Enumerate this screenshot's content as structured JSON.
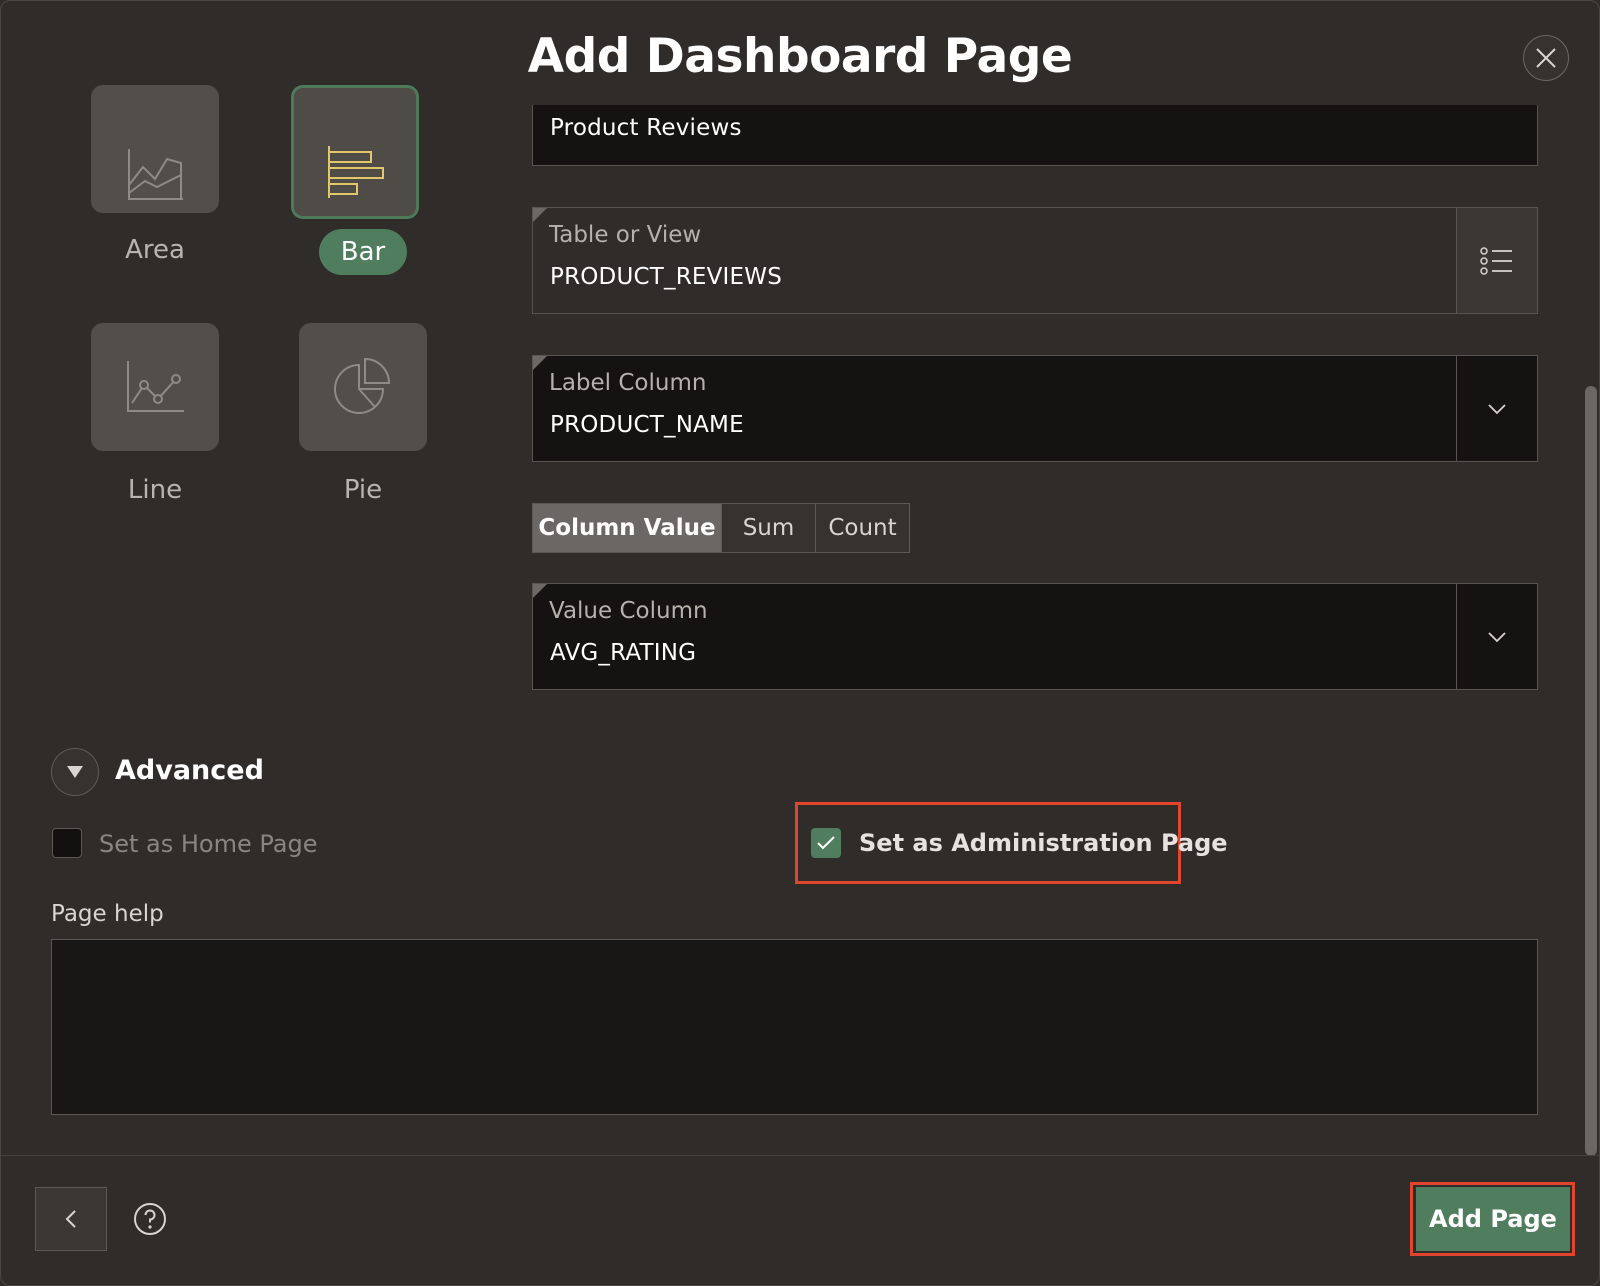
{
  "dialog": {
    "title": "Add Dashboard Page"
  },
  "chart_types": {
    "area": "Area",
    "bar": "Bar",
    "line": "Line",
    "pie": "Pie",
    "selected": "Bar"
  },
  "fields": {
    "page_name_value": "Product Reviews",
    "table_or_view_label": "Table or View",
    "table_or_view_value": "PRODUCT_REVIEWS",
    "label_column_label": "Label Column",
    "label_column_value": "PRODUCT_NAME",
    "value_column_label": "Value Column",
    "value_column_value": "AVG_RATING"
  },
  "aggregation": {
    "options": [
      "Column Value",
      "Sum",
      "Count"
    ],
    "selected": "Column Value"
  },
  "advanced": {
    "label": "Advanced",
    "home_page_label": "Set as Home Page",
    "home_page_checked": false,
    "admin_page_label": "Set as Administration Page",
    "admin_page_checked": true,
    "page_help_label": "Page help",
    "page_help_value": ""
  },
  "footer": {
    "add_page_label": "Add Page"
  },
  "colors": {
    "accent": "#4f7d5d",
    "highlight": "#e0452e",
    "background": "#2f2c2a",
    "bar_icon": "#e2c76a"
  }
}
